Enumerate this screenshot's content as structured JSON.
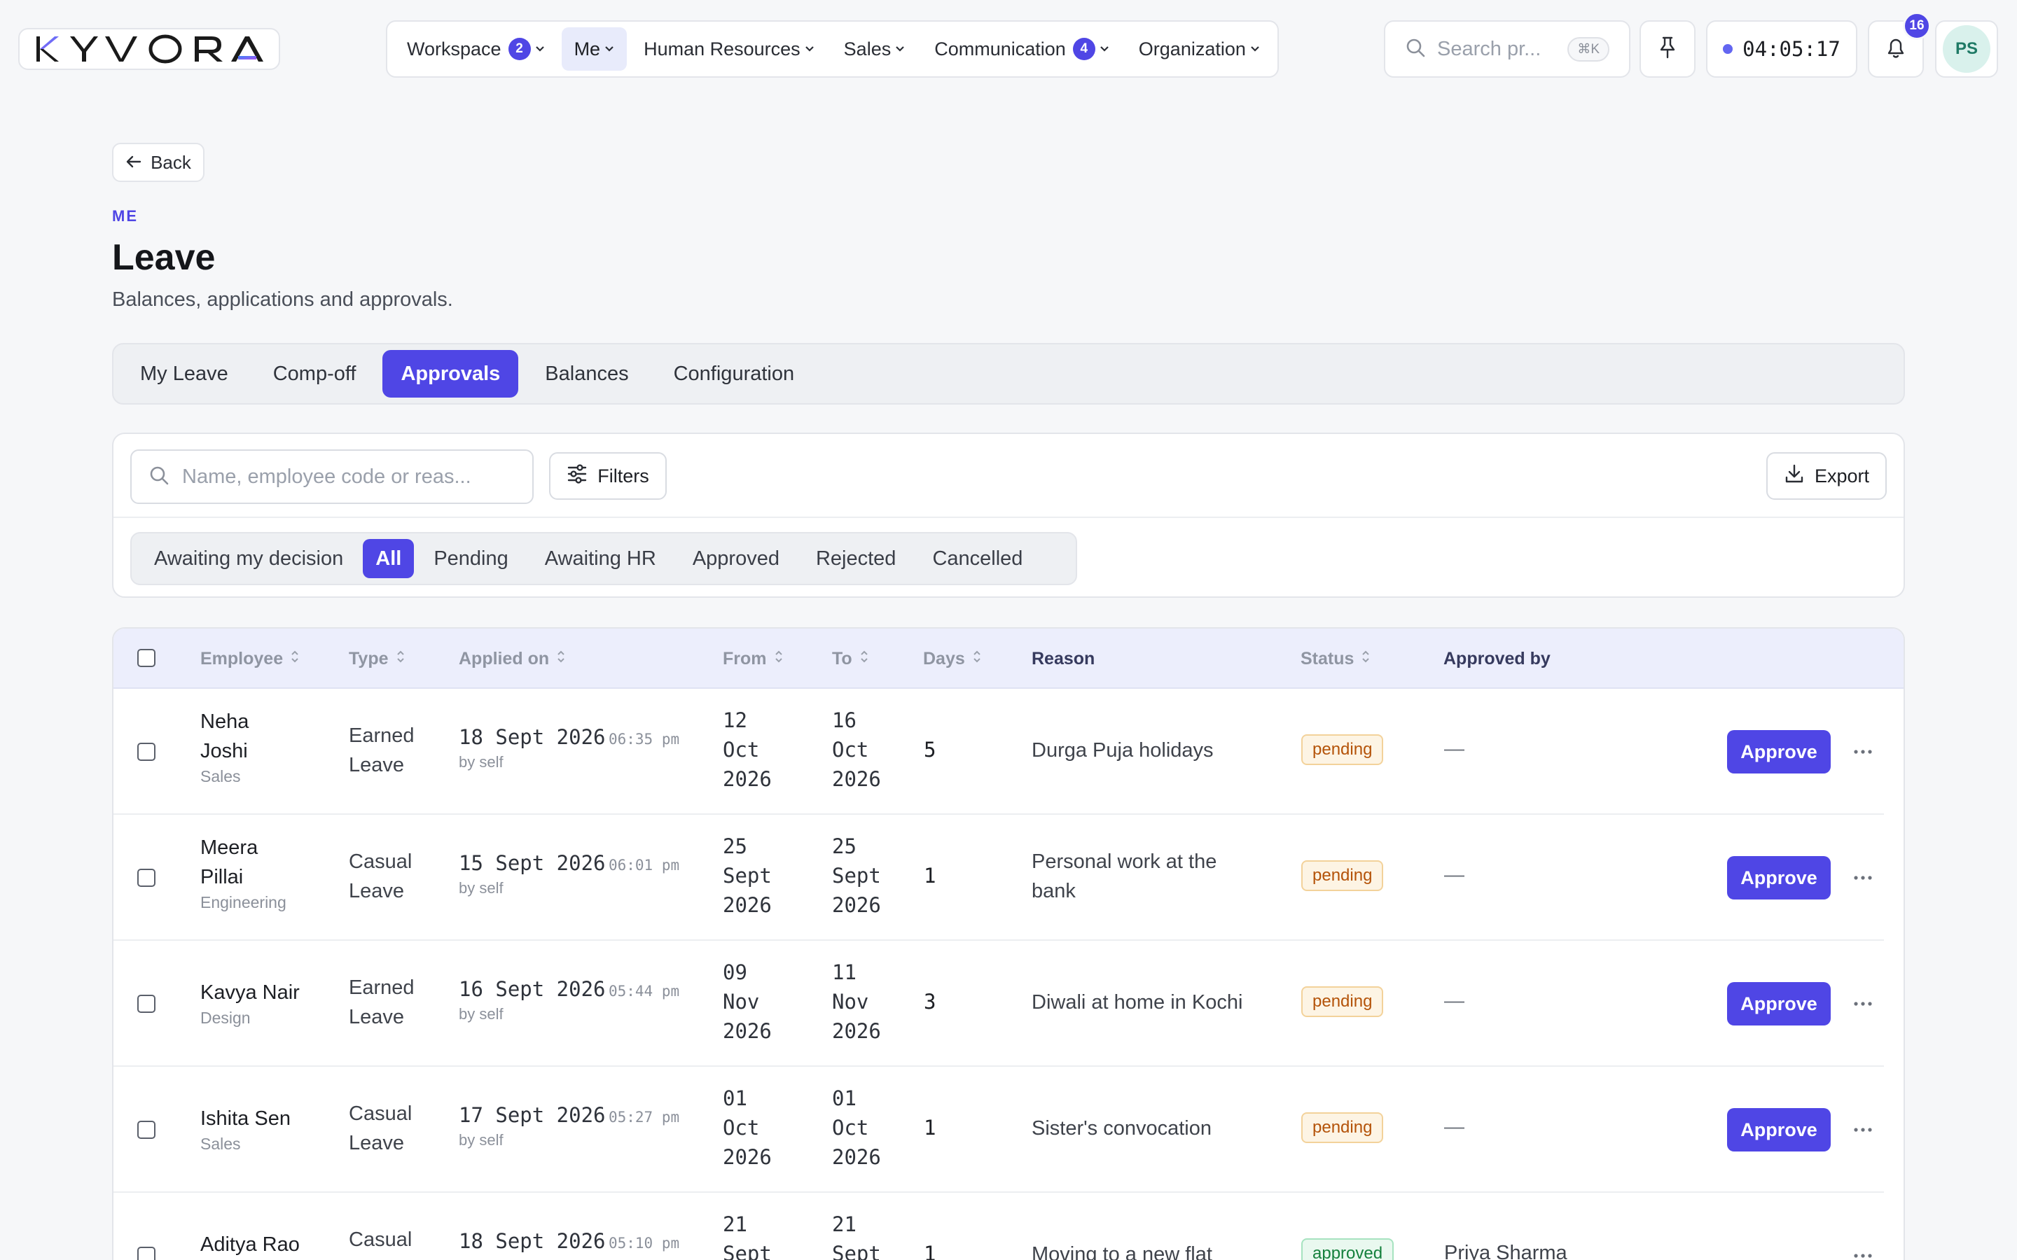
{
  "brand": {
    "logo_text": "KYVORA"
  },
  "nav": {
    "items": [
      {
        "label": "Workspace",
        "badge": "2"
      },
      {
        "label": "Me",
        "badge": "",
        "active": true
      },
      {
        "label": "Human Resources",
        "badge": ""
      },
      {
        "label": "Sales",
        "badge": ""
      },
      {
        "label": "Communication",
        "badge": "4"
      },
      {
        "label": "Organization",
        "badge": ""
      }
    ]
  },
  "topbar": {
    "search_placeholder": "Search pr...",
    "shortcut": "⌘K",
    "timer": "04:05:17",
    "notification_count": "16",
    "avatar_initials": "PS"
  },
  "page": {
    "back_label": "Back",
    "eyebrow": "ME",
    "title": "Leave",
    "subtitle": "Balances, applications and approvals."
  },
  "tabs": [
    {
      "label": "My Leave"
    },
    {
      "label": "Comp-off"
    },
    {
      "label": "Approvals",
      "active": true
    },
    {
      "label": "Balances"
    },
    {
      "label": "Configuration"
    }
  ],
  "filters": {
    "search_placeholder": "Name, employee code or reas...",
    "filters_label": "Filters",
    "export_label": "Export",
    "segments": [
      {
        "label": "Awaiting my decision"
      },
      {
        "label": "All",
        "active": true
      },
      {
        "label": "Pending"
      },
      {
        "label": "Awaiting HR"
      },
      {
        "label": "Approved"
      },
      {
        "label": "Rejected"
      },
      {
        "label": "Cancelled"
      }
    ]
  },
  "table": {
    "columns": {
      "employee": "Employee",
      "type": "Type",
      "applied_on": "Applied on",
      "from": "From",
      "to": "To",
      "days": "Days",
      "reason": "Reason",
      "status": "Status",
      "approved_by": "Approved by"
    },
    "approve_label": "Approve",
    "rows": [
      {
        "name_line1": "Neha",
        "name_line2": "Joshi",
        "dept": "Sales",
        "type_line1": "Earned",
        "type_line2": "Leave",
        "applied_date": "18 Sept 2026",
        "applied_time": "06:35 pm",
        "applied_by": "by self",
        "from_day": "12",
        "from_month": "Oct",
        "from_year": "2026",
        "to_day": "16",
        "to_month": "Oct",
        "to_year": "2026",
        "days": "5",
        "reason_line1": "Durga Puja holidays",
        "reason_line2": "",
        "status": "pending",
        "approved_by": "—"
      },
      {
        "name_line1": "Meera",
        "name_line2": "Pillai",
        "dept": "Engineering",
        "type_line1": "Casual",
        "type_line2": "Leave",
        "applied_date": "15 Sept 2026",
        "applied_time": "06:01 pm",
        "applied_by": "by self",
        "from_day": "25",
        "from_month": "Sept",
        "from_year": "2026",
        "to_day": "25",
        "to_month": "Sept",
        "to_year": "2026",
        "days": "1",
        "reason_line1": "Personal work at the",
        "reason_line2": "bank",
        "status": "pending",
        "approved_by": "—"
      },
      {
        "name_line1": "Kavya Nair",
        "name_line2": "",
        "dept": "Design",
        "type_line1": "Earned",
        "type_line2": "Leave",
        "applied_date": "16 Sept 2026",
        "applied_time": "05:44 pm",
        "applied_by": "by self",
        "from_day": "09",
        "from_month": "Nov",
        "from_year": "2026",
        "to_day": "11",
        "to_month": "Nov",
        "to_year": "2026",
        "days": "3",
        "reason_line1": "Diwali at home in Kochi",
        "reason_line2": "",
        "status": "pending",
        "approved_by": "—"
      },
      {
        "name_line1": "Ishita Sen",
        "name_line2": "",
        "dept": "Sales",
        "type_line1": "Casual",
        "type_line2": "Leave",
        "applied_date": "17 Sept 2026",
        "applied_time": "05:27 pm",
        "applied_by": "by self",
        "from_day": "01",
        "from_month": "Oct",
        "from_year": "2026",
        "to_day": "01",
        "to_month": "Oct",
        "to_year": "2026",
        "days": "1",
        "reason_line1": "Sister's convocation",
        "reason_line2": "",
        "status": "pending",
        "approved_by": "—"
      },
      {
        "name_line1": "Aditya Rao",
        "name_line2": "",
        "dept": "",
        "type_line1": "Casual",
        "type_line2": "",
        "applied_date": "18 Sept 2026",
        "applied_time": "05:10 pm",
        "applied_by": "",
        "from_day": "21",
        "from_month": "Sept",
        "from_year": "",
        "to_day": "21",
        "to_month": "Sept",
        "to_year": "",
        "days": "1",
        "reason_line1": "Moving to a new flat",
        "reason_line2": "",
        "status": "approved",
        "approved_by": "Priya Sharma"
      }
    ]
  }
}
